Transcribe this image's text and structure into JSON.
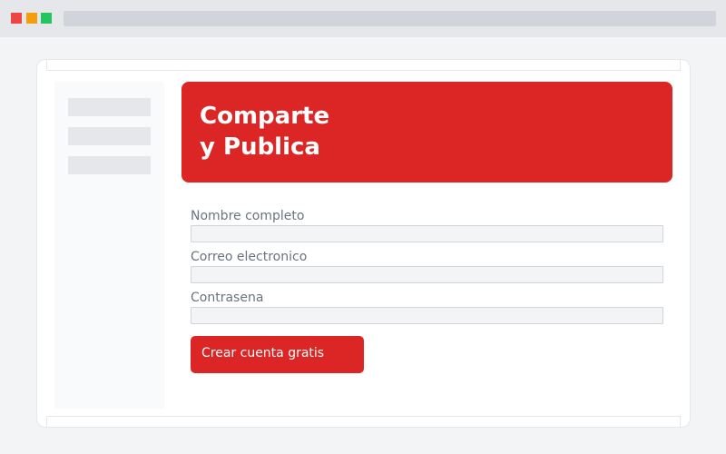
{
  "colors": {
    "accent": "#dc2626",
    "traffic_red": "#ef4444",
    "traffic_yellow": "#f59e0b",
    "traffic_green": "#22c55e"
  },
  "hero": {
    "line1": "Comparte",
    "line2": "y Publica"
  },
  "form": {
    "fields": [
      {
        "label": "Nombre completo",
        "value": "",
        "placeholder": ""
      },
      {
        "label": "Correo electronico",
        "value": "",
        "placeholder": ""
      },
      {
        "label": "Contrasena",
        "value": "",
        "placeholder": ""
      }
    ],
    "submit_label": "Crear cuenta gratis"
  }
}
